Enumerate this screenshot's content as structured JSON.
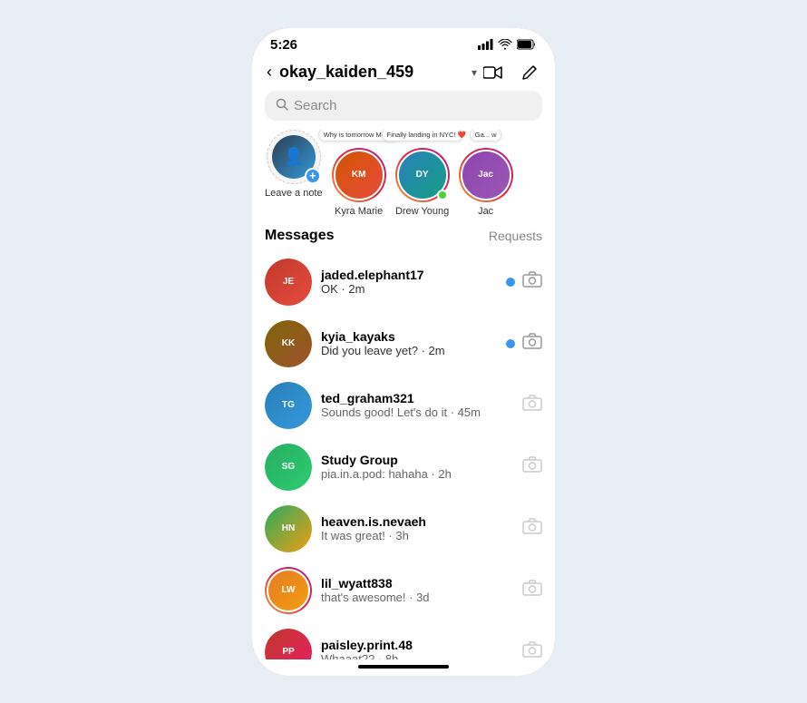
{
  "phone": {
    "status_bar": {
      "time": "5:26",
      "signal_icon": "signal",
      "wifi_icon": "wifi",
      "battery_icon": "battery"
    },
    "header": {
      "back_label": "‹",
      "username": "okay_kaiden_459",
      "chevron": "▾",
      "video_icon": "video",
      "edit_icon": "edit"
    },
    "search": {
      "placeholder": "Search"
    },
    "stories": [
      {
        "id": "add-note",
        "label": "Leave a note",
        "type": "add",
        "color": "av-indigo"
      },
      {
        "id": "kyra-marie",
        "label": "Kyra Marie",
        "type": "note",
        "note": "Why is tomorrow Monday!? 😑",
        "color": "av-warm"
      },
      {
        "id": "drew-young",
        "label": "Drew Young",
        "type": "online",
        "note": "Finally landing in NYC! ❤️",
        "color": "av-sky"
      },
      {
        "id": "jac",
        "label": "Jac",
        "type": "partial",
        "note": "Ga... w",
        "color": "av-purple"
      }
    ],
    "sections": {
      "messages_label": "Messages",
      "requests_label": "Requests"
    },
    "messages": [
      {
        "id": "jaded-elephant17",
        "username": "jaded.elephant17",
        "preview": "OK · 2m",
        "unread": true,
        "has_ring": false,
        "color": "av-red"
      },
      {
        "id": "kyia-kayaks",
        "username": "kyia_kayaks",
        "preview": "Did you leave yet? · 2m",
        "unread": true,
        "has_ring": false,
        "color": "av-brown"
      },
      {
        "id": "ted-graham321",
        "username": "ted_graham321",
        "preview": "Sounds good! Let's do it · 45m",
        "unread": false,
        "has_ring": false,
        "color": "av-blue"
      },
      {
        "id": "study-group",
        "username": "Study Group",
        "preview": "pia.in.a.pod: hahaha · 2h",
        "unread": false,
        "has_ring": false,
        "color": "av-green",
        "is_group": true
      },
      {
        "id": "heaven-nevaeh",
        "username": "heaven.is.nevaeh",
        "preview": "It was great! · 3h",
        "unread": false,
        "has_ring": false,
        "color": "av-nature"
      },
      {
        "id": "lil-wyatt838",
        "username": "lil_wyatt838",
        "preview": "that's awesome! · 3d",
        "unread": false,
        "has_ring": true,
        "color": "av-orange"
      },
      {
        "id": "paisley-print48",
        "username": "paisley.print.48",
        "preview": "Whaaat?? · 8h",
        "unread": false,
        "has_ring": false,
        "color": "av-pink"
      }
    ]
  }
}
